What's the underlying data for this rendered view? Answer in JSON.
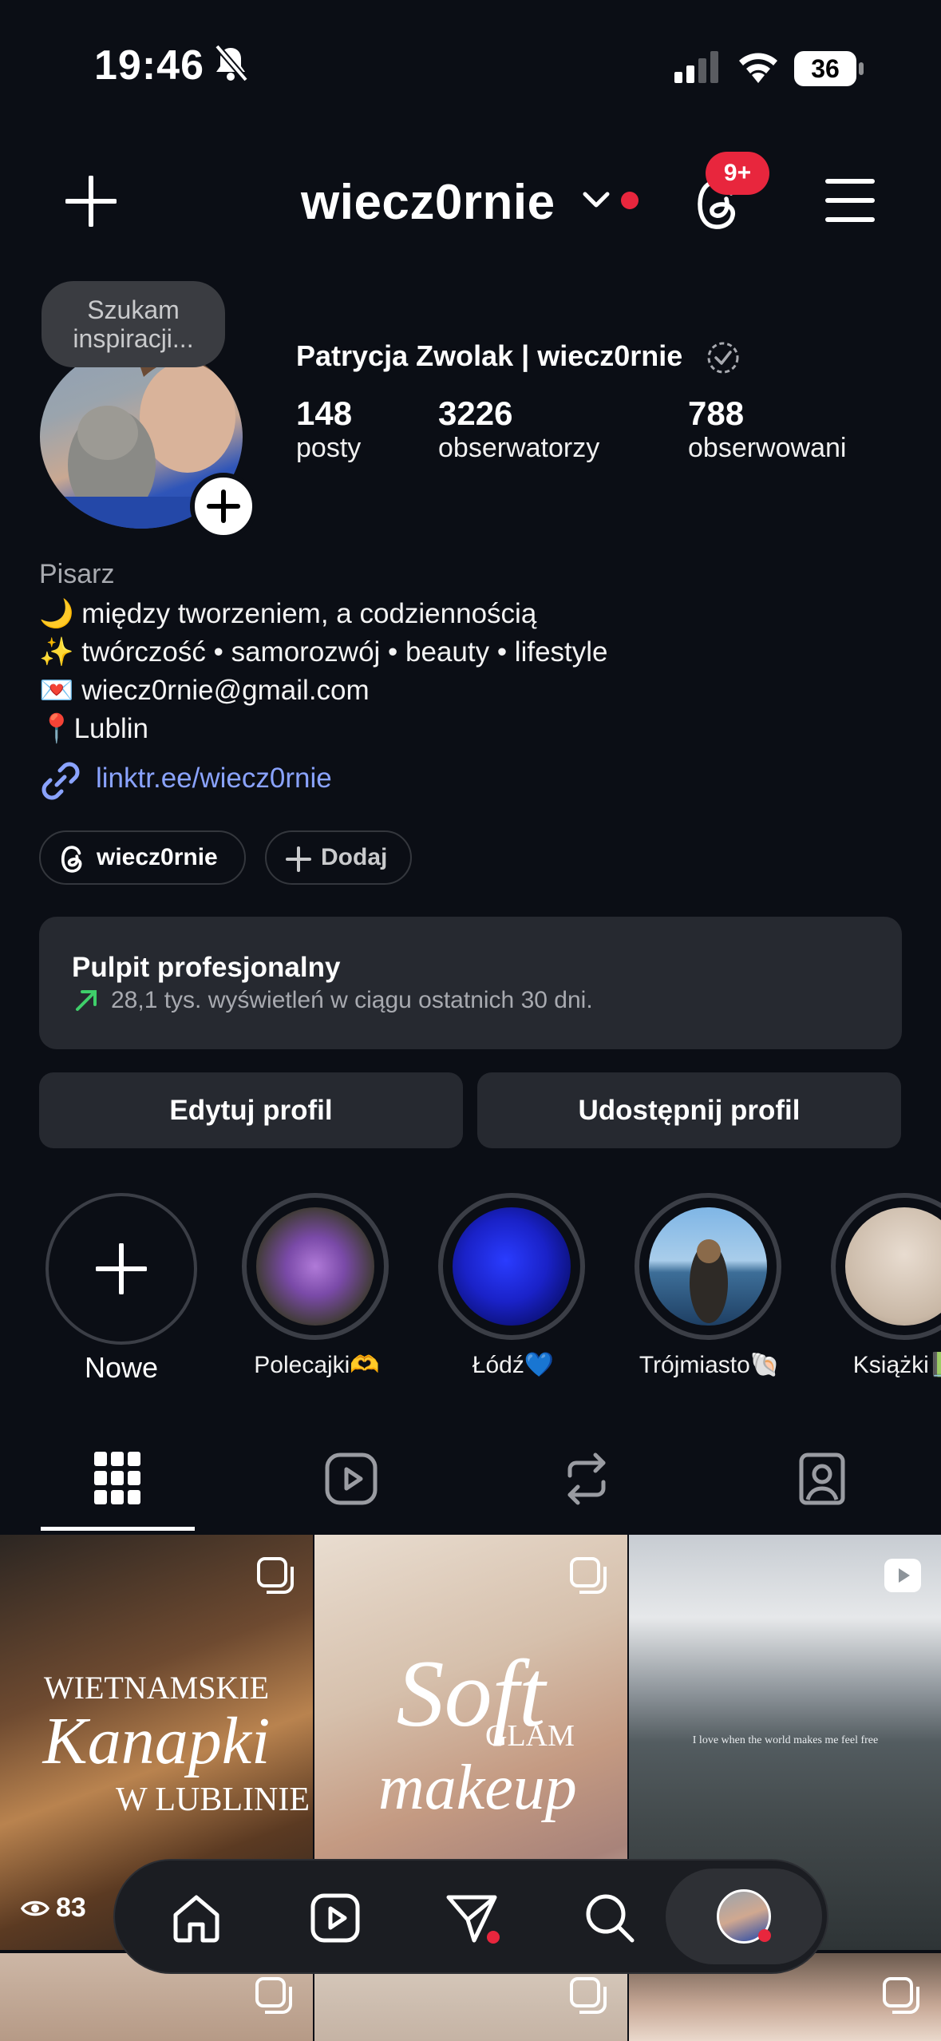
{
  "status_bar": {
    "time": "19:46",
    "battery": "36"
  },
  "header": {
    "username": "wiecz0rnie",
    "notification_badge": "9+"
  },
  "profile": {
    "note": "Szukam inspiracji...",
    "full_name": "Patrycja Zwolak | wiecz0rnie",
    "stats": [
      {
        "value": "148",
        "label": "posty"
      },
      {
        "value": "3226",
        "label": "obserwatorzy"
      },
      {
        "value": "788",
        "label": "obserwowani"
      }
    ],
    "category": "Pisarz",
    "bio_lines": [
      "🌙 między tworzeniem, a codziennością",
      "✨ twórczość • samorozwój • beauty • lifestyle",
      "💌 wiecz0rnie@gmail.com",
      "📍Lublin"
    ],
    "link": "linktr.ee/wiecz0rnie"
  },
  "chips": {
    "threads_label": "wiecz0rnie",
    "add_label": "Dodaj"
  },
  "dashboard": {
    "title": "Pulpit profesjonalny",
    "subtitle": "28,1 tys. wyświetleń w ciągu ostatnich 30 dni."
  },
  "buttons": {
    "edit": "Edytuj profil",
    "share": "Udostępnij profil"
  },
  "highlights": [
    {
      "label": "Nowe"
    },
    {
      "label": "Polecajki🫶"
    },
    {
      "label": "Łódź💙"
    },
    {
      "label": "Trójmiasto🐚"
    },
    {
      "label": "Książki📗"
    }
  ],
  "posts": [
    {
      "overlay_line1": "WIETNAMSKIE",
      "overlay_line2": "Kanapki",
      "overlay_line3": "W LUBLINIE",
      "views": "83"
    },
    {
      "overlay_line1": "Soft",
      "overlay_line2": "GLAM",
      "overlay_line3": "makeup"
    },
    {
      "overlay_line1": "I love when the world makes me feel free"
    }
  ],
  "colors": {
    "background": "#0b0e15",
    "card": "#262930",
    "link": "#8aa3ff",
    "badge": "#e8263d"
  }
}
